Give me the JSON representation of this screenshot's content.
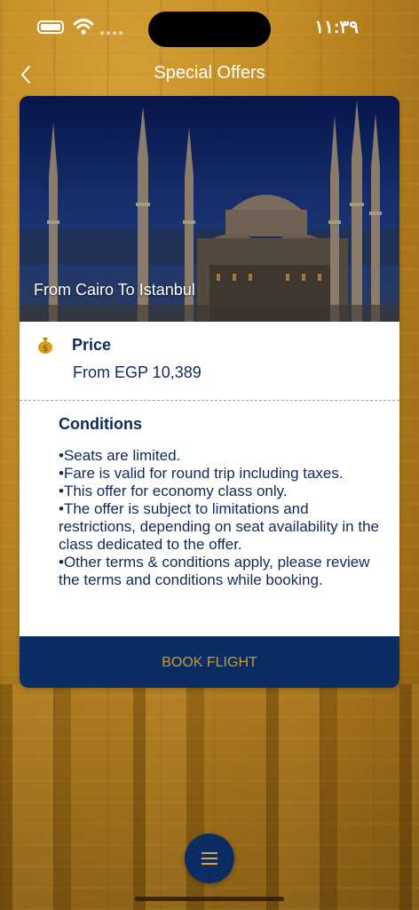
{
  "status_bar": {
    "time": "١١:٣٩"
  },
  "nav": {
    "title": "Special Offers"
  },
  "offer": {
    "route": "From Cairo To Istanbul",
    "price_heading": "Price",
    "price_value": "From EGP 10,389",
    "conditions_heading": "Conditions",
    "conditions": [
      "•Seats are limited.",
      "•Fare is valid for round trip including taxes.",
      "•This offer for economy class only.",
      "•The offer is subject to limitations and restrictions, depending on seat availability in the class dedicated to the offer.",
      "•Other terms & conditions apply, please review the terms and conditions while booking."
    ],
    "book_label": "BOOK FLIGHT"
  },
  "icons": {
    "back": "chevron-left-icon",
    "money": "money-bag-icon",
    "menu": "hamburger-menu-icon"
  },
  "colors": {
    "navy": "#0b2d63",
    "gold": "#c99a2e",
    "text_navy": "#0f2a5a"
  }
}
